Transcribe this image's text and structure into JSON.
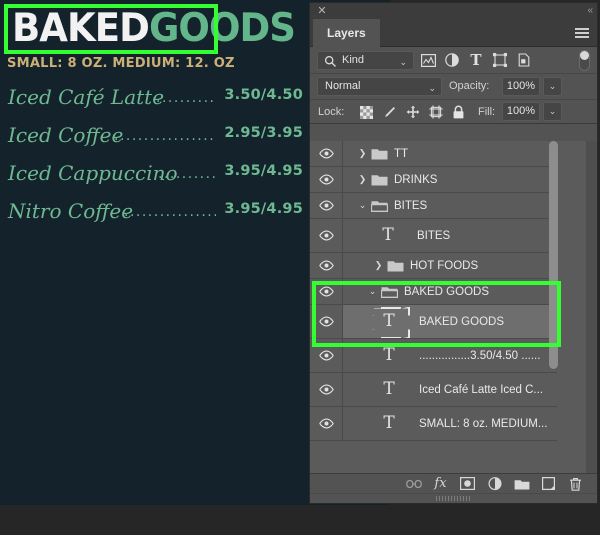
{
  "canvas": {
    "background_color": "#13222b",
    "title": {
      "word1": "BAKED",
      "word2": "GOODS",
      "word1_color": "#f2f2f2",
      "word2_color": "#63b58a"
    },
    "subtitle": "SMALL: 8 OZ. MEDIUM: 12. OZ",
    "subtitle_color": "#cbb077",
    "menu_items": [
      {
        "name": "Iced Café Latte",
        "dots": "................",
        "price": "3.50/4.50"
      },
      {
        "name": "Iced Coffee",
        "dots": ".......................",
        "price": "2.95/3.95"
      },
      {
        "name": "Iced Cappuccino",
        "dots": "................",
        "price": "3.95/4.95"
      },
      {
        "name": "Nitro Coffee",
        "dots": "......................",
        "price": "3.95/4.95"
      }
    ],
    "menu_text_color": "#6fb992",
    "highlight_color": "#33ff33"
  },
  "panel": {
    "titlebar": {
      "close_label": "✕",
      "collapse_label": "«"
    },
    "tab": {
      "label": "Layers",
      "menu_label": "panel-menu"
    },
    "filter": {
      "kind_label": "Kind",
      "icons": [
        "pixel-layer-filter-icon",
        "adjustment-layer-filter-icon",
        "type-layer-filter-icon",
        "shape-layer-filter-icon",
        "smart-object-filter-icon"
      ],
      "toggle_label": "filter-toggle"
    },
    "blend": {
      "mode": "Normal",
      "opacity_label": "Opacity:",
      "opacity_value": "100%",
      "stepper_label": "⌄"
    },
    "lock": {
      "label": "Lock:",
      "icons": [
        "lock-transparency-icon",
        "lock-image-icon",
        "lock-position-icon",
        "lock-artboard-icon",
        "lock-all-icon"
      ],
      "fill_label": "Fill:",
      "fill_value": "100%"
    },
    "layers": [
      {
        "name": "TT",
        "type": "group",
        "expanded": false,
        "indent": 0,
        "visible": true,
        "selected": false
      },
      {
        "name": "DRINKS",
        "type": "group",
        "expanded": false,
        "indent": 0,
        "visible": true,
        "selected": false
      },
      {
        "name": "BITES",
        "type": "group",
        "expanded": true,
        "indent": 0,
        "visible": true,
        "selected": false
      },
      {
        "name": "BITES",
        "type": "text",
        "indent": 1,
        "visible": true,
        "selected": false
      },
      {
        "name": "HOT FOODS",
        "type": "group",
        "expanded": false,
        "indent": 1,
        "visible": true,
        "selected": false
      },
      {
        "name": "BAKED GOODS",
        "type": "group",
        "expanded": true,
        "indent": 1,
        "visible": true,
        "selected": false,
        "highlighted": true
      },
      {
        "name": "BAKED GOODS",
        "type": "text",
        "indent": 2,
        "visible": true,
        "selected": true,
        "highlighted": true
      },
      {
        "name": "................3.50/4.50 ......",
        "type": "text",
        "indent": 2,
        "visible": true,
        "selected": false
      },
      {
        "name": "Iced Café Latte Iced C...",
        "type": "text",
        "indent": 2,
        "visible": true,
        "selected": false
      },
      {
        "name": "SMALL: 8 oz. MEDIUM...",
        "type": "text",
        "indent": 2,
        "visible": true,
        "selected": false
      }
    ],
    "toolbar": {
      "buttons": [
        "link-layers-icon",
        "add-layer-style-icon",
        "add-layer-mask-icon",
        "new-adjustment-layer-icon",
        "new-group-icon",
        "new-layer-icon",
        "delete-layer-icon"
      ],
      "fx_label": "fx"
    },
    "scrollbar": {
      "name": "layer-list-scrollbar"
    }
  }
}
